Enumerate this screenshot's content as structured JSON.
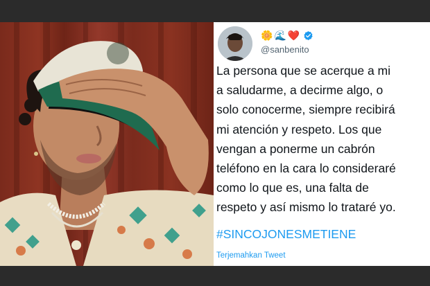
{
  "photo": {
    "alt": ""
  },
  "tweet": {
    "emojis": [
      "🌼",
      "🌊",
      "❤️"
    ],
    "verified_icon": "verified-badge-icon",
    "handle": "@sanbenito",
    "lines": [
      "La persona que se acerque a mi",
      "a saludarme, a decirme algo, o",
      "solo conocerme, siempre recibirá",
      "mi atención y respeto. Los que",
      "vengan a ponerme un cabrón",
      "teléfono en la cara lo consideraré",
      "como lo que es, una falta de",
      "respeto y así mismo lo trataré yo."
    ],
    "hashtag": "#SINCOJONESMETIENE",
    "translate": "Terjemahkan Tweet"
  },
  "colors": {
    "link": "#1d9bf0",
    "verified": "#1d9bf0",
    "text": "#0f1419",
    "muted": "#536471"
  }
}
